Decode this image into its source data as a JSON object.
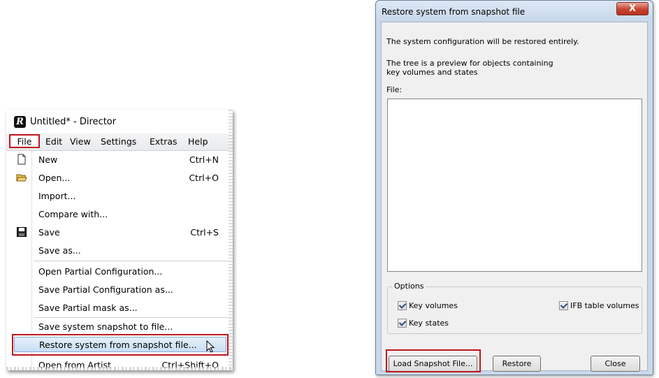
{
  "menu_window": {
    "logo_letter": "R",
    "title": "Untitled* - Director",
    "menubar": [
      "File",
      "Edit",
      "View",
      "Settings",
      "Extras",
      "Help"
    ],
    "items": [
      {
        "label": "New",
        "shortcut": "Ctrl+N",
        "icon": "new-file-icon"
      },
      {
        "label": "Open...",
        "shortcut": "Ctrl+O",
        "icon": "open-folder-icon"
      },
      {
        "label": "Import...",
        "shortcut": ""
      },
      {
        "label": "Compare with...",
        "shortcut": ""
      },
      {
        "label": "Save",
        "shortcut": "Ctrl+S",
        "icon": "save-disk-icon"
      },
      {
        "label": "Save as...",
        "shortcut": ""
      },
      {
        "label": "Open Partial Configuration...",
        "shortcut": ""
      },
      {
        "label": "Save Partial Configuration as...",
        "shortcut": ""
      },
      {
        "label": "Save Partial mask as...",
        "shortcut": ""
      },
      {
        "label": "Save system snapshot to file...",
        "shortcut": ""
      },
      {
        "label": "Restore system from snapshot file...",
        "shortcut": ""
      },
      {
        "label": "Open from Artist",
        "shortcut": "Ctrl+Shift+O"
      }
    ]
  },
  "dialog": {
    "title": "Restore system from snapshot file",
    "close_glyph": "X",
    "line1": "The system configuration will be restored entirely.",
    "line2a": "The tree is a preview for objects containing",
    "line2b": "key volumes and states",
    "file_label": "File:",
    "options_label": "Options",
    "checkboxes": [
      {
        "label": "Key volumes",
        "checked": true
      },
      {
        "label": "IFB table volumes",
        "checked": true
      },
      {
        "label": "Key states",
        "checked": true
      }
    ],
    "buttons": {
      "load": "Load Snapshot File...",
      "restore": "Restore",
      "close": "Close"
    }
  },
  "colors": {
    "highlight_red": "#c0161d",
    "menu_highlight": "#c9dff5",
    "dialog_frame": "#c9d9ec"
  }
}
